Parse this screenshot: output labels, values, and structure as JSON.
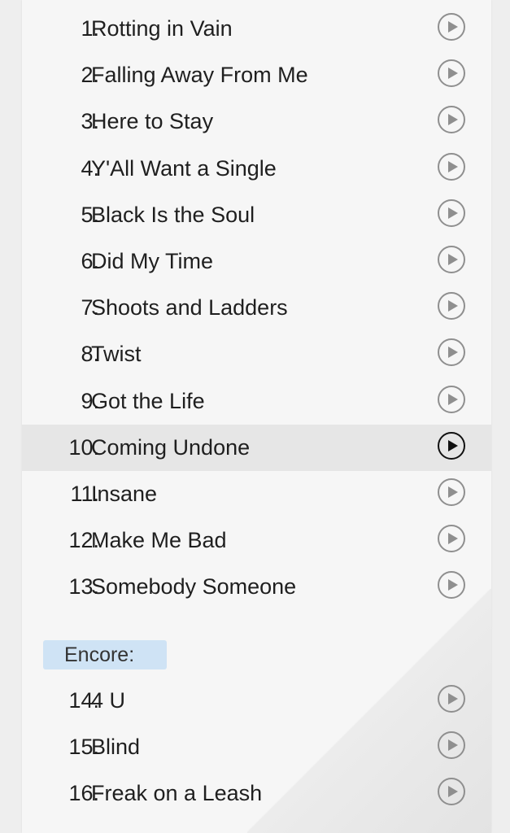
{
  "setlist": {
    "tracks": [
      {
        "number": "1.",
        "title": "Rotting in Vain"
      },
      {
        "number": "2.",
        "title": "Falling Away From Me"
      },
      {
        "number": "3.",
        "title": "Here to Stay"
      },
      {
        "number": "4.",
        "title": "Y'All Want a Single"
      },
      {
        "number": "5.",
        "title": "Black Is the Soul"
      },
      {
        "number": "6.",
        "title": "Did My Time"
      },
      {
        "number": "7.",
        "title": "Shoots and Ladders"
      },
      {
        "number": "8.",
        "title": "Twist"
      },
      {
        "number": "9.",
        "title": "Got the Life"
      },
      {
        "number": "10.",
        "title": "Coming Undone",
        "active": true
      },
      {
        "number": "11.",
        "title": "Insane"
      },
      {
        "number": "12.",
        "title": "Make Me Bad"
      },
      {
        "number": "13.",
        "title": "Somebody Someone"
      }
    ],
    "encore_label": "Encore:",
    "encore_tracks": [
      {
        "number": "14.",
        "title": "4 U"
      },
      {
        "number": "15.",
        "title": "Blind"
      },
      {
        "number": "16.",
        "title": "Freak on a Leash"
      }
    ]
  },
  "colors": {
    "active_row": "#e6e6e6",
    "encore_highlight": "#cfe3f5",
    "play_icon": "#8f8f8f",
    "play_icon_active": "#111111"
  },
  "icons": {
    "play": "play-circle-icon"
  }
}
